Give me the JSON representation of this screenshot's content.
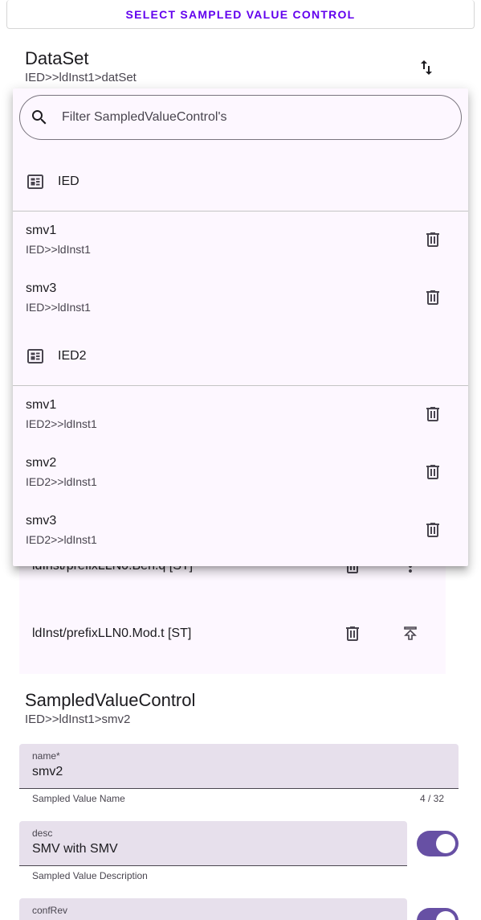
{
  "select_button": {
    "label": "SELECT SAMPLED VALUE CONTROL"
  },
  "dataset": {
    "title": "DataSet",
    "path": "IED>>ldInst1>datSet"
  },
  "filter": {
    "placeholder": "Filter SampledValueControl's"
  },
  "groups": [
    {
      "name": "IED",
      "items": [
        {
          "name": "smv1",
          "path": "IED>>ldInst1"
        },
        {
          "name": "smv3",
          "path": "IED>>ldInst1"
        }
      ]
    },
    {
      "name": "IED2",
      "items": [
        {
          "name": "smv1",
          "path": "IED2>>ldInst1"
        },
        {
          "name": "smv2",
          "path": "IED2>>ldInst1"
        },
        {
          "name": "smv3",
          "path": "IED2>>ldInst1"
        }
      ]
    }
  ],
  "background_rows": [
    {
      "label": "ldInst/prefixLLN0.Beh.q [ST]"
    },
    {
      "label": "ldInst/prefixLLN0.Mod.t [ST]"
    }
  ],
  "svc": {
    "title": "SampledValueControl",
    "path": "IED>>ldInst1>smv2"
  },
  "fields": {
    "name": {
      "label": "name*",
      "value": "smv2",
      "helper": "Sampled Value Name",
      "counter": "4 / 32"
    },
    "desc": {
      "label": "desc",
      "value": "SMV with SMV",
      "helper": "Sampled Value Description"
    },
    "confRev": {
      "label": "confRev"
    }
  },
  "colors": {
    "accent": "#6200ee",
    "toggle": "#6750a4",
    "surface": "#fdf7ff",
    "field": "#e7e0ec"
  }
}
